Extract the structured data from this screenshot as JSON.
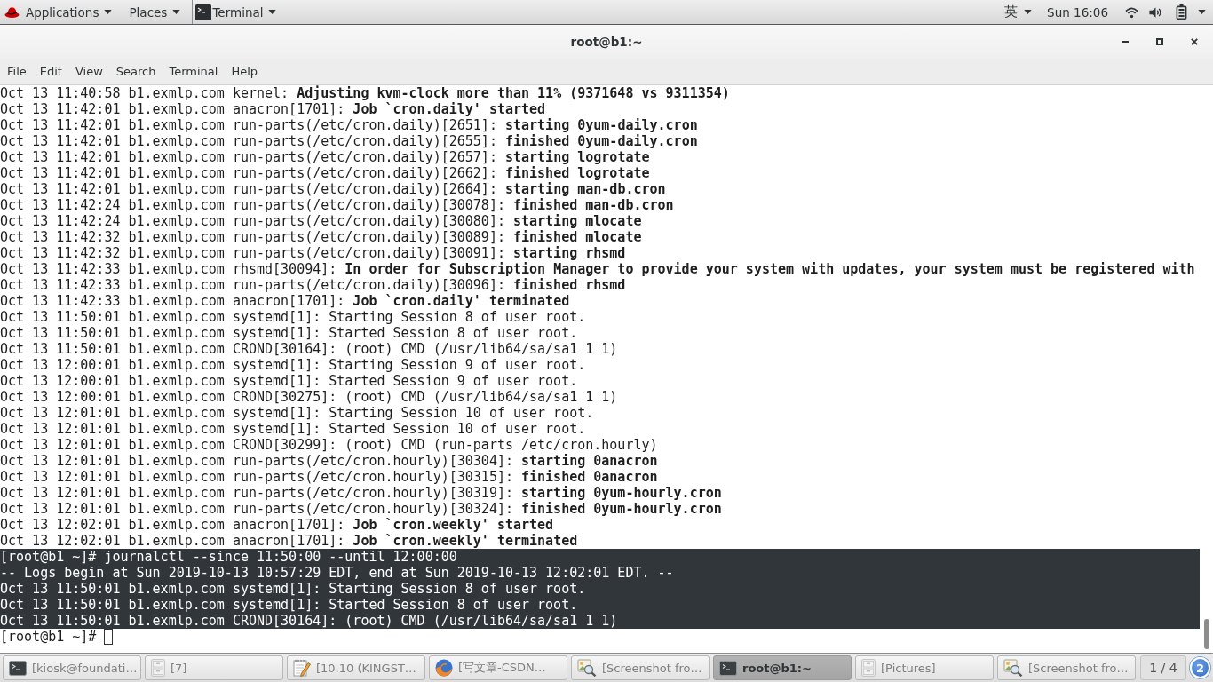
{
  "top_panel": {
    "applications": "Applications",
    "places": "Places",
    "app_menu": "Terminal",
    "input_method": "英",
    "clock": "Sun 16:06"
  },
  "window": {
    "title": "root@b1:~",
    "menu": [
      "File",
      "Edit",
      "View",
      "Search",
      "Terminal",
      "Help"
    ]
  },
  "terminal": {
    "lines": [
      {
        "text": "Oct 13 11:40:58 b1.exmlp.com kernel: **Adjusting kvm-clock more than 11% (9371648 vs 9311354)**",
        "selected": false
      },
      {
        "text": "Oct 13 11:42:01 b1.exmlp.com anacron[1701]: **Job `cron.daily' started**",
        "selected": false
      },
      {
        "text": "Oct 13 11:42:01 b1.exmlp.com run-parts(/etc/cron.daily)[2651]: **starting 0yum-daily.cron**",
        "selected": false
      },
      {
        "text": "Oct 13 11:42:01 b1.exmlp.com run-parts(/etc/cron.daily)[2655]: **finished 0yum-daily.cron**",
        "selected": false
      },
      {
        "text": "Oct 13 11:42:01 b1.exmlp.com run-parts(/etc/cron.daily)[2657]: **starting logrotate**",
        "selected": false
      },
      {
        "text": "Oct 13 11:42:01 b1.exmlp.com run-parts(/etc/cron.daily)[2662]: **finished logrotate**",
        "selected": false
      },
      {
        "text": "Oct 13 11:42:01 b1.exmlp.com run-parts(/etc/cron.daily)[2664]: **starting man-db.cron**",
        "selected": false
      },
      {
        "text": "Oct 13 11:42:24 b1.exmlp.com run-parts(/etc/cron.daily)[30078]: **finished man-db.cron**",
        "selected": false
      },
      {
        "text": "Oct 13 11:42:24 b1.exmlp.com run-parts(/etc/cron.daily)[30080]: **starting mlocate**",
        "selected": false
      },
      {
        "text": "Oct 13 11:42:32 b1.exmlp.com run-parts(/etc/cron.daily)[30089]: **finished mlocate**",
        "selected": false
      },
      {
        "text": "Oct 13 11:42:32 b1.exmlp.com run-parts(/etc/cron.daily)[30091]: **starting rhsmd**",
        "selected": false
      },
      {
        "text": "Oct 13 11:42:33 b1.exmlp.com rhsmd[30094]: **In order for Subscription Manager to provide your system with updates, your system must be registered with**",
        "selected": false
      },
      {
        "text": "Oct 13 11:42:33 b1.exmlp.com run-parts(/etc/cron.daily)[30096]: **finished rhsmd**",
        "selected": false
      },
      {
        "text": "Oct 13 11:42:33 b1.exmlp.com anacron[1701]: **Job `cron.daily' terminated**",
        "selected": false
      },
      {
        "text": "Oct 13 11:50:01 b1.exmlp.com systemd[1]: Starting Session 8 of user root.",
        "selected": false
      },
      {
        "text": "Oct 13 11:50:01 b1.exmlp.com systemd[1]: Started Session 8 of user root.",
        "selected": false
      },
      {
        "text": "Oct 13 11:50:01 b1.exmlp.com CROND[30164]: (root) CMD (/usr/lib64/sa/sa1 1 1)",
        "selected": false
      },
      {
        "text": "Oct 13 12:00:01 b1.exmlp.com systemd[1]: Starting Session 9 of user root.",
        "selected": false
      },
      {
        "text": "Oct 13 12:00:01 b1.exmlp.com systemd[1]: Started Session 9 of user root.",
        "selected": false
      },
      {
        "text": "Oct 13 12:00:01 b1.exmlp.com CROND[30275]: (root) CMD (/usr/lib64/sa/sa1 1 1)",
        "selected": false
      },
      {
        "text": "Oct 13 12:01:01 b1.exmlp.com systemd[1]: Starting Session 10 of user root.",
        "selected": false
      },
      {
        "text": "Oct 13 12:01:01 b1.exmlp.com systemd[1]: Started Session 10 of user root.",
        "selected": false
      },
      {
        "text": "Oct 13 12:01:01 b1.exmlp.com CROND[30299]: (root) CMD (run-parts /etc/cron.hourly)",
        "selected": false
      },
      {
        "text": "Oct 13 12:01:01 b1.exmlp.com run-parts(/etc/cron.hourly)[30304]: **starting 0anacron**",
        "selected": false
      },
      {
        "text": "Oct 13 12:01:01 b1.exmlp.com run-parts(/etc/cron.hourly)[30315]: **finished 0anacron**",
        "selected": false
      },
      {
        "text": "Oct 13 12:01:01 b1.exmlp.com run-parts(/etc/cron.hourly)[30319]: **starting 0yum-hourly.cron**",
        "selected": false
      },
      {
        "text": "Oct 13 12:01:01 b1.exmlp.com run-parts(/etc/cron.hourly)[30324]: **finished 0yum-hourly.cron**",
        "selected": false
      },
      {
        "text": "Oct 13 12:02:01 b1.exmlp.com anacron[1701]: **Job `cron.weekly' started**",
        "selected": false
      },
      {
        "text": "Oct 13 12:02:01 b1.exmlp.com anacron[1701]: **Job `cron.weekly' terminated**",
        "selected": false
      },
      {
        "text": "[root@b1 ~]# journalctl --since 11:50:00 --until 12:00:00",
        "selected": true
      },
      {
        "text": "-- Logs begin at Sun 2019-10-13 10:57:29 EDT, end at Sun 2019-10-13 12:02:01 EDT. --",
        "selected": true
      },
      {
        "text": "Oct 13 11:50:01 b1.exmlp.com systemd[1]: Starting Session 8 of user root.",
        "selected": true
      },
      {
        "text": "Oct 13 11:50:01 b1.exmlp.com systemd[1]: Started Session 8 of user root.",
        "selected": true
      },
      {
        "text": "Oct 13 11:50:01 b1.exmlp.com CROND[30164]: (root) CMD (/usr/lib64/sa/sa1 1 1)",
        "selected": true
      }
    ],
    "prompt": {
      "text": "[root@b1 ~]#",
      "cursor": true
    }
  },
  "taskbar": {
    "windows": [
      {
        "label": "[kiosk@foundati…",
        "kind": "terminal",
        "selected": false
      },
      {
        "label": "[7]",
        "kind": "files",
        "selected": false
      },
      {
        "label": "[10.10 (KINGST…",
        "kind": "editor",
        "selected": false
      },
      {
        "label": "[写文章-CSDN…",
        "kind": "browser",
        "selected": false
      },
      {
        "label": "[Screenshot fro…",
        "kind": "viewer",
        "selected": false
      },
      {
        "label": "root@b1:~",
        "kind": "terminal",
        "selected": true
      },
      {
        "label": "[Pictures]",
        "kind": "files",
        "selected": false
      },
      {
        "label": "[Screenshot fro…",
        "kind": "viewer",
        "selected": false
      }
    ],
    "workspace": "1 / 4",
    "notifications": "2"
  }
}
